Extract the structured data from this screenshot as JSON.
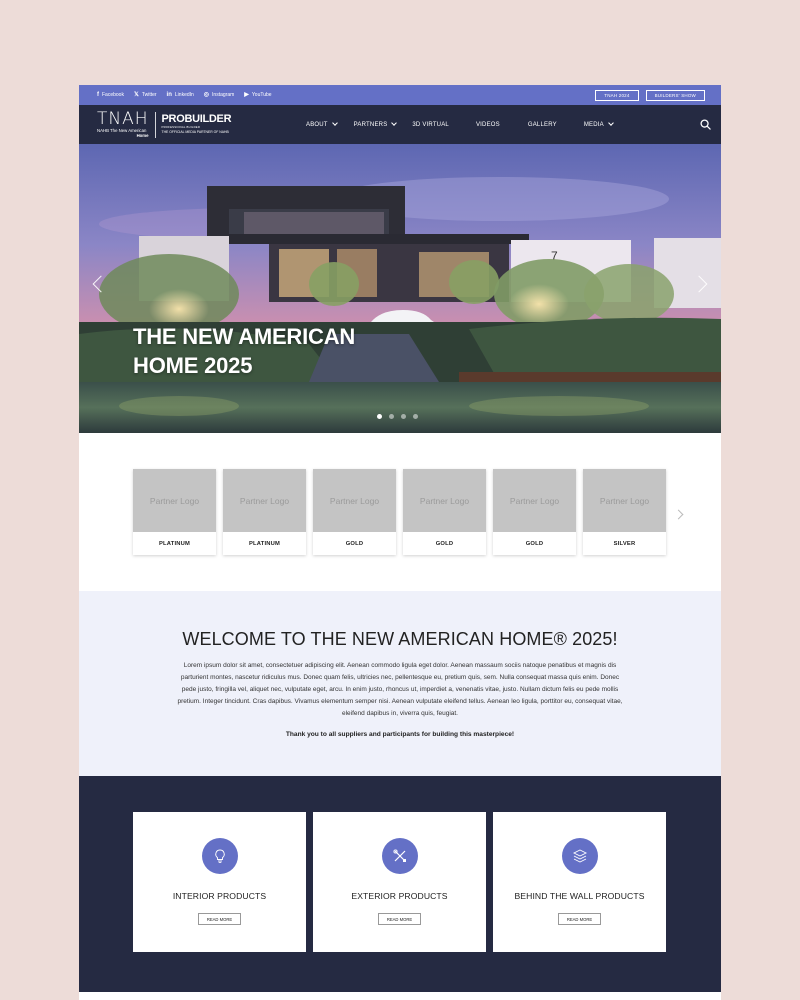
{
  "topbar": {
    "social": [
      {
        "icon": "facebook-icon",
        "glyph": "f",
        "label": "Facebook"
      },
      {
        "icon": "twitter-icon",
        "glyph": "𝕏",
        "label": "Twitter"
      },
      {
        "icon": "linkedin-icon",
        "glyph": "in",
        "label": "LinkedIn"
      },
      {
        "icon": "instagram-icon",
        "glyph": "◎",
        "label": "Instagram"
      },
      {
        "icon": "youtube-icon",
        "glyph": "▶",
        "label": "YouTube"
      }
    ],
    "buttons": [
      "TNAH 2024",
      "BUILDERS' SHOW"
    ]
  },
  "logo": {
    "tnah": "TNAH",
    "tnah_sub": "NAHB The New American",
    "tnah_sub2": "Home",
    "probuilder": "PROBUILDER",
    "probuilder_tag": "PROFESSIONAL BUILDER",
    "probuilder_tag2": "THE OFFICIAL MEDIA PARTNER OF NAHB"
  },
  "nav": {
    "items": [
      {
        "label": "ABOUT",
        "dropdown": true
      },
      {
        "label": "PARTNERS",
        "dropdown": true
      },
      {
        "label": "3D VIRTUAL",
        "dropdown": false
      },
      {
        "label": "VIDEOS",
        "dropdown": false
      },
      {
        "label": "GALLERY",
        "dropdown": false
      },
      {
        "label": "MEDIA",
        "dropdown": true
      }
    ]
  },
  "hero": {
    "title_line1": "THE NEW AMERICAN",
    "title_line2": "HOME 2025",
    "house_number": "7",
    "slides": 4,
    "active_slide": 1
  },
  "partners": {
    "placeholder": "Partner Logo",
    "tiers": [
      "PLATINUM",
      "PLATINUM",
      "GOLD",
      "GOLD",
      "GOLD",
      "SILVER"
    ]
  },
  "welcome": {
    "title": "WELCOME TO THE NEW AMERICAN HOME® 2025!",
    "body": "Lorem ipsum dolor sit amet, consectetuer adipiscing elit. Aenean commodo ligula eget dolor. Aenean massaum sociis natoque penatibus et magnis dis parturient montes, nascetur ridiculus mus. Donec quam felis, ultricies nec, pellentesque eu, pretium quis, sem. Nulla consequat massa quis enim. Donec pede justo, fringilla vel, aliquet nec, vulputate eget, arcu. In enim justo, rhoncus ut, imperdiet a, venenatis vitae, justo. Nullam dictum felis eu pede mollis pretium. Integer tincidunt. Cras dapibus. Vivamus elementum semper nisi. Aenean vulputate eleifend tellus. Aenean leo ligula, porttitor eu, consequat vitae, eleifend dapibus in, viverra quis, feugiat.",
    "thanks": "Thank you to all suppliers and participants for building this masterpiece!"
  },
  "products": [
    {
      "title": "INTERIOR PRODUCTS",
      "icon": "lightbulb-icon",
      "button": "READ MORE"
    },
    {
      "title": "EXTERIOR PRODUCTS",
      "icon": "tools-icon",
      "button": "READ MORE"
    },
    {
      "title": "BEHIND THE WALL PRODUCTS",
      "icon": "layers-icon",
      "button": "READ MORE"
    }
  ],
  "colors": {
    "accent": "#6470c6",
    "navy": "#252a42",
    "welcome_bg": "#eff1fa",
    "page_bg": "#eddcd8"
  }
}
